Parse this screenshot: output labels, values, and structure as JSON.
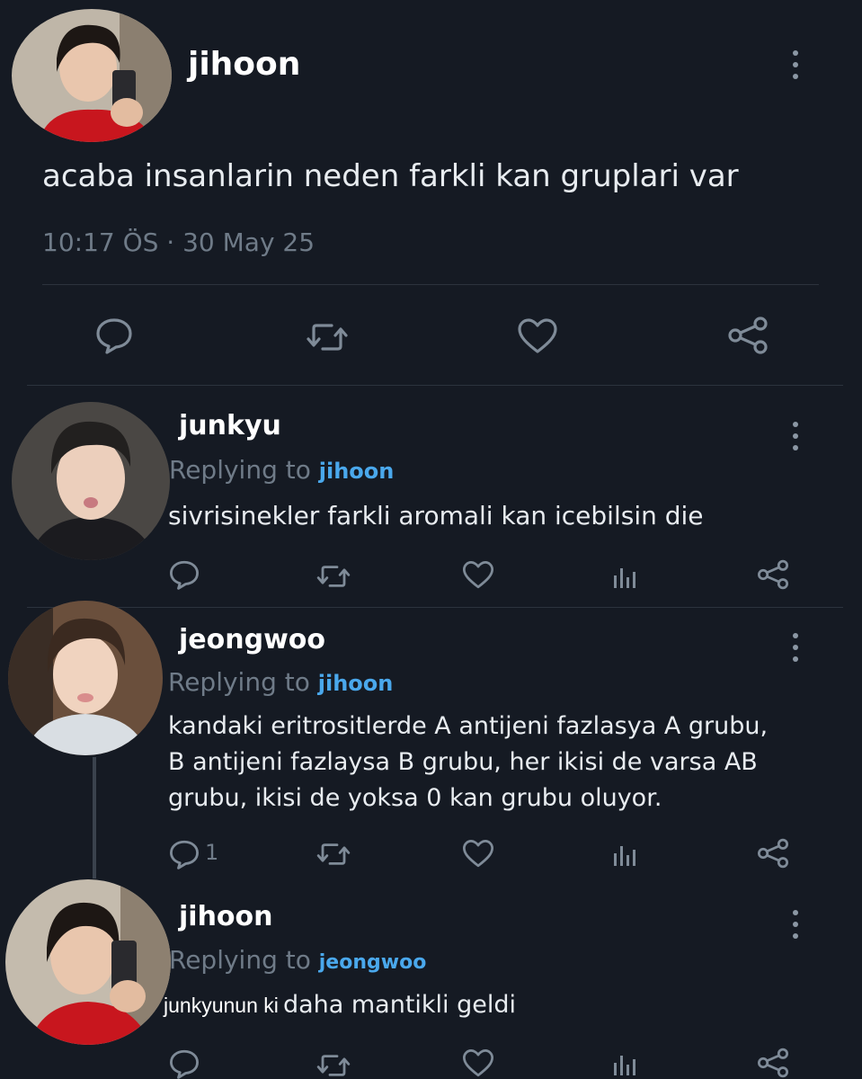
{
  "main_tweet": {
    "author": "jihoon",
    "text": "acaba insanlarin neden farkli kan gruplari var",
    "meta": "10:17 ÖS · 30 May 25",
    "actions": [
      "reply-icon",
      "retweet-icon",
      "like-icon",
      "share-icon"
    ]
  },
  "replying_prefix": "Replying to",
  "replies": [
    {
      "author": "junkyu",
      "replying_to": "jihoon",
      "lines": [
        "sivrisinekler farkli aromali kan icebilsin die"
      ],
      "reply_count": ""
    },
    {
      "author": "jeongwoo",
      "replying_to": "jihoon",
      "lines": [
        "kandaki eritrositlerde A antijeni fazlasya A grubu,",
        "B antijeni fazlaysa B grubu, her ikisi de varsa AB",
        "grubu, ikisi de yoksa 0 kan grubu oluyor."
      ],
      "reply_count": "1"
    },
    {
      "author": "jihoon",
      "replying_to": "jeongwoo",
      "text_part1": "junkyunun ki",
      "text_part2": "daha mantikli geldi",
      "reply_count": ""
    }
  ],
  "colors": {
    "background": "#151a23",
    "link": "#4aa8ec",
    "muted": "#6f7b88",
    "icon": "#7f8b98"
  }
}
